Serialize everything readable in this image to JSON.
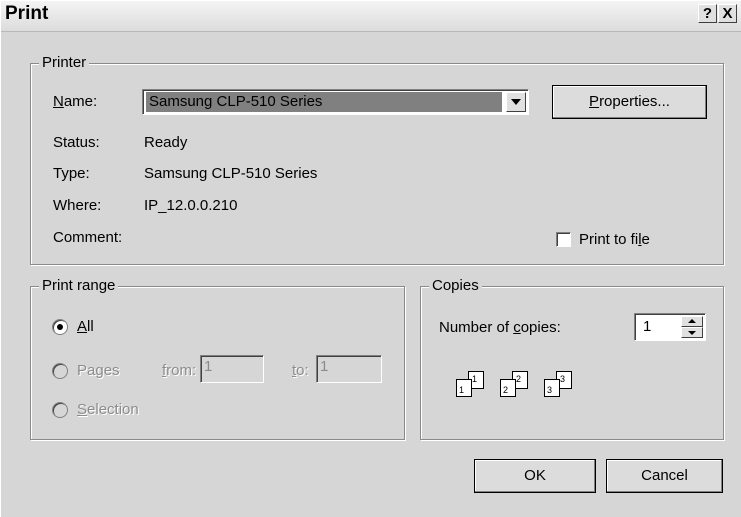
{
  "dialog": {
    "title": "Print",
    "help_label": "?",
    "close_label": "X"
  },
  "printer": {
    "group_label": "Printer",
    "name_label": "Name:",
    "name_value": "Samsung CLP-510 Series",
    "properties_label": "Properties...",
    "status_label": "Status:",
    "status_value": "Ready",
    "type_label": "Type:",
    "type_value": "Samsung CLP-510 Series",
    "where_label": "Where:",
    "where_value": "IP_12.0.0.210",
    "comment_label": "Comment:",
    "print_to_file_label": "Print to file",
    "print_to_file_checked": false
  },
  "range": {
    "group_label": "Print range",
    "all_label": "All",
    "pages_label": "Pages",
    "from_label": "from:",
    "from_value": "1",
    "to_label": "to:",
    "to_value": "1",
    "selection_label": "Selection",
    "selected": "All"
  },
  "copies": {
    "group_label": "Copies",
    "number_label": "Number of copies:",
    "number_value": "1",
    "collate_pages": [
      "1",
      "1",
      "2",
      "2",
      "3",
      "3"
    ]
  },
  "buttons": {
    "ok": "OK",
    "cancel": "Cancel"
  },
  "colors": {
    "dialog_bg": "#d6d6d6",
    "selection_bg": "#808080"
  }
}
